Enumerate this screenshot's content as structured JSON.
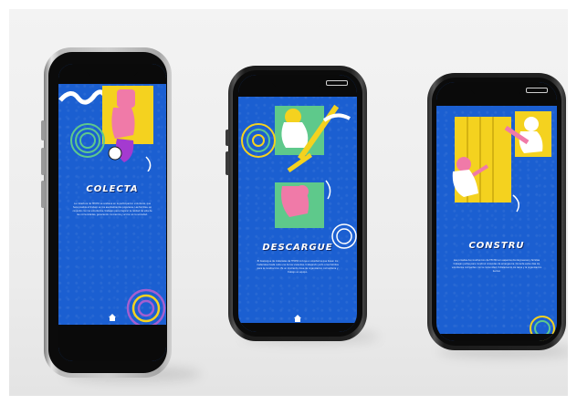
{
  "palette": {
    "screen_blue": "#1b5fd1",
    "accent_yellow": "#f4d21f",
    "accent_green": "#5ec98b",
    "accent_pink": "#f07aa8",
    "accent_purple": "#a45fd0"
  },
  "phones": [
    {
      "name": "left",
      "frame": "silver",
      "section_title": "COLECTA",
      "body_text": "La cobertura de TECHO se sostiene en la participacion voluntaria, que hace posible el trabajo en los asentamientos populares. Las familias, en conjunto con los voluntarios, trabajan para mejorar la calidad de vida de las comunidades, generando conciencia y accion en la sociedad.",
      "caption": "",
      "icons": [
        "home-icon"
      ]
    },
    {
      "name": "middle",
      "frame": "dark",
      "section_title": "DESCARGUE",
      "body_text": "El descargue de materiales de TECHO incluye a voluntarios que llevan los materiales hasta cada una de las viviendas, trabajando junto a las familias para la construccion. Es un momento clave de organizacion comunitaria y trabajo en equipo.",
      "caption": "",
      "icons": [
        "home-icon"
      ]
    },
    {
      "name": "right",
      "frame": "black",
      "section_title": "CONSTRU",
      "body_text": "Las jornadas de construccion de TECHO son espacios donde jovenes y familias trabajan juntas para construir viviendas de emergencia. Durante estos dias los voluntarios comparten con la comunidad, fortaleciendo los lazos y la organizacion barrial.",
      "caption": "",
      "icons": [
        "home-icon"
      ]
    }
  ]
}
